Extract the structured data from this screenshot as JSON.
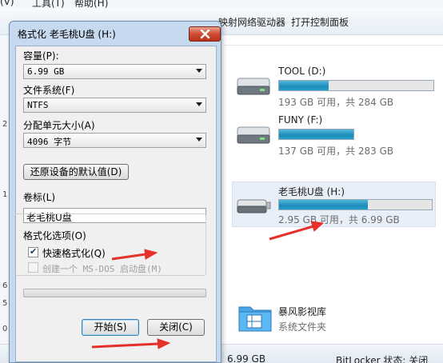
{
  "explorer": {
    "menu": [
      "(V)",
      "工具(T)",
      "帮助(H)"
    ],
    "toolbar": {
      "map_drive": "映射网络驱动器",
      "control_panel": "打开控制面板"
    },
    "drives": [
      {
        "name": "TOOL (D:)",
        "space": "193 GB 可用，共 284 GB",
        "used_fraction": 0.32
      },
      {
        "name": "FUNY (F:)",
        "space": "137 GB 可用，共 283 GB",
        "used_fraction": 0.52
      },
      {
        "name": "老毛桃U盘 (H:)",
        "space": "2.95 GB 可用，共 6.99 GB",
        "used_fraction": 0.58
      }
    ],
    "folder": {
      "name": "暴风影视库",
      "type": "系统文件夹"
    },
    "statusbar": {
      "total_size": "6.99 GB",
      "bitlocker": "BitLocker 状态: 关闭"
    },
    "edge_digits": [
      "2",
      "1",
      "6",
      "5",
      "0"
    ]
  },
  "dialog": {
    "title": "格式化 老毛桃U盘 (H:)",
    "capacity_label": "容量(P):",
    "capacity_value": "6.99 GB",
    "filesystem_label": "文件系统(F)",
    "filesystem_value": "NTFS",
    "unit_label": "分配单元大小(A)",
    "unit_value": "4096 字节",
    "restore_defaults": "还原设备的默认值(D)",
    "volume_label": "卷标(L)",
    "volume_value": "老毛桃U盘",
    "options_label": "格式化选项(O)",
    "quick_format": "快速格式化(Q)",
    "quick_format_checked": true,
    "msdos_disk": "创建一个 MS-DOS 启动盘(M)",
    "start": "开始(S)",
    "close": "关闭(C)"
  },
  "colors": {
    "annotation_arrow": "#e8302a",
    "drive_bar": "#26a0cc",
    "close_button": "#cf4c32"
  }
}
